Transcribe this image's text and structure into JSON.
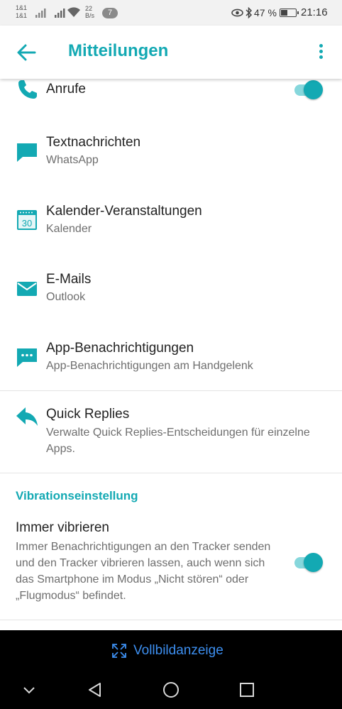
{
  "status_bar": {
    "carrier_1": "1&1",
    "carrier_2": "1&1",
    "speed_value": "22",
    "speed_unit": "B/s",
    "notification_count": "7",
    "battery": "47 %",
    "time": "21:16",
    "battery_level": 0.47
  },
  "app_bar": {
    "title": "Mitteilungen"
  },
  "notifications": [
    {
      "title": "Anrufe",
      "subtitle": "",
      "icon": "phone-icon",
      "toggle_on": true
    },
    {
      "title": "Textnachrichten",
      "subtitle": "WhatsApp",
      "icon": "message-icon"
    },
    {
      "title": "Kalender-Veranstaltungen",
      "subtitle": "Kalender",
      "icon": "calendar-icon",
      "icon_text": "30"
    },
    {
      "title": "E-Mails",
      "subtitle": "Outlook",
      "icon": "mail-icon"
    },
    {
      "title": "App-Benachrichtigungen",
      "subtitle": "App-Benachrichtigungen am Handgelenk",
      "icon": "chat-dots-icon"
    }
  ],
  "quick_replies": {
    "title": "Quick Replies",
    "subtitle": "Verwalte Quick Replies-Entscheidungen für einzelne Apps.",
    "icon": "reply-icon"
  },
  "vibration": {
    "section_title": "Vibrationseinstellung",
    "title": "Immer vibrieren",
    "description": "Immer Benachrichtigungen an den Tracker senden und den Tracker vibrieren lassen, auch wenn sich das Smartphone im Modus „Nicht stören“ oder „Flugmodus“ befindet.",
    "toggle_on": true
  },
  "fullscreen_bar": {
    "label": "Vollbildanzeige",
    "icon": "fullscreen-icon"
  },
  "colors": {
    "accent": "#13a9b3",
    "accent_light": "#86d7dc",
    "link_blue": "#3d8ff0"
  }
}
